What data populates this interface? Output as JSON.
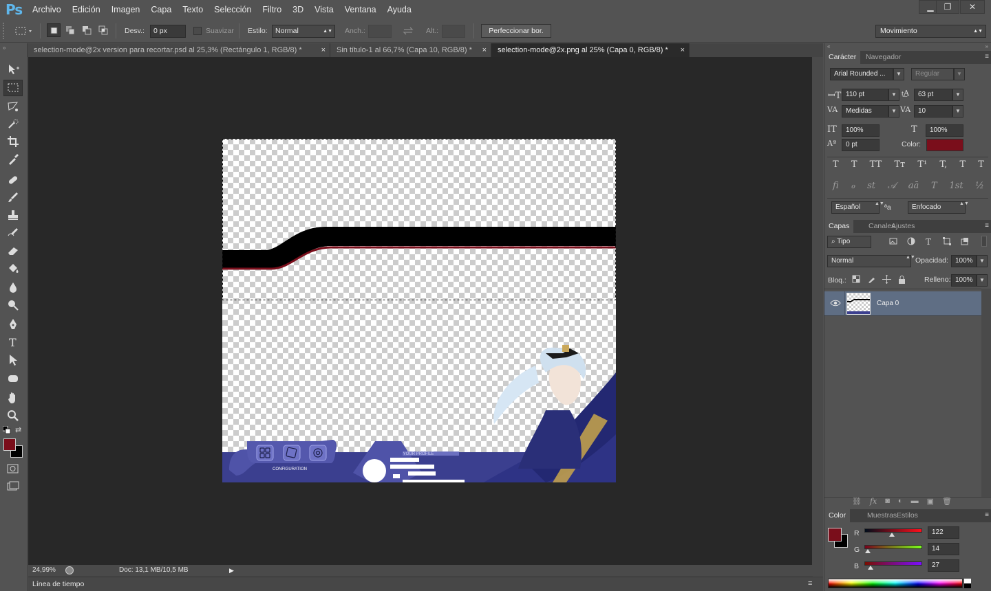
{
  "app": {
    "logo": "Ps",
    "accent": "#5fb7ec"
  },
  "menu": [
    "Archivo",
    "Edición",
    "Imagen",
    "Capa",
    "Texto",
    "Selección",
    "Filtro",
    "3D",
    "Vista",
    "Ventana",
    "Ayuda"
  ],
  "window_controls": {
    "minimize": "▁",
    "restore": "❐",
    "close": "✕"
  },
  "options": {
    "desv_label": "Desv.:",
    "desv_value": "0 px",
    "suavizar_label": "Suavizar",
    "estilo_label": "Estilo:",
    "estilo_value": "Normal",
    "anch_label": "Anch.:",
    "alt_label": "Alt.:",
    "refine_button": "Perfeccionar bor.",
    "workspace": "Movimiento"
  },
  "doc_tabs": [
    {
      "label": "selection-mode@2x version para recortar.psd al 25,3% (Rectángulo 1, RGB/8) *",
      "active": false
    },
    {
      "label": "Sin título-1 al 66,7% (Capa 10, RGB/8) *",
      "active": false
    },
    {
      "label": "selection-mode@2x.png al 25% (Capa 0, RGB/8) *",
      "active": true
    }
  ],
  "tools": [
    "move-tool",
    "marquee-tool",
    "lasso-tool",
    "quick-select-tool",
    "crop-tool",
    "eyedropper-tool",
    "healing-tool",
    "brush-tool",
    "stamp-tool",
    "history-brush-tool",
    "eraser-tool",
    "paint-bucket-tool",
    "blur-tool",
    "dodge-tool",
    "pen-tool",
    "type-tool",
    "path-select-tool",
    "shape-tool",
    "hand-tool",
    "zoom-tool"
  ],
  "colors": {
    "foreground": "#7a0e1b",
    "background": "#000000"
  },
  "status": {
    "zoom": "24,99%",
    "doc": "Doc: 13,1 MB/10,5 MB"
  },
  "timeline_label": "Línea de tiempo",
  "character_panel": {
    "tabs": [
      "Carácter",
      "Navegador"
    ],
    "font_family": "Arial Rounded ...",
    "font_style": "Regular",
    "size": "110 pt",
    "leading": "63 pt",
    "kerning": "Medidas",
    "tracking": "10",
    "vscale": "100%",
    "hscale": "100%",
    "baseline": "0 pt",
    "color_label": "Color:",
    "text_color": "#7a0e1b",
    "language": "Español",
    "aa_icon": "ªa",
    "antialias": "Enfocado",
    "style_glyphs": [
      "T",
      "T",
      "TT",
      "Tт",
      "T¹",
      "T,",
      "T",
      "T"
    ],
    "ot_glyphs": [
      "fi",
      "ℴ",
      "st",
      "𝒜",
      "aā",
      "T",
      "1st",
      "½"
    ]
  },
  "layers_panel": {
    "tabs": [
      "Capas",
      "Canales",
      "Ajustes"
    ],
    "filter": "Tipo",
    "blend": "Normal",
    "opacity_label": "Opacidad:",
    "opacity": "100%",
    "lock_label": "Bloq.:",
    "fill_label": "Relleno:",
    "fill": "100%",
    "layers": [
      {
        "name": "Capa 0",
        "visible": true,
        "selected": true
      }
    ]
  },
  "color_panel": {
    "tabs": [
      "Color",
      "Muestras",
      "Estilos"
    ],
    "channels": [
      {
        "label": "R",
        "value": "122",
        "fraction": 0.478
      },
      {
        "label": "G",
        "value": "14",
        "fraction": 0.055
      },
      {
        "label": "B",
        "value": "27",
        "fraction": 0.106
      }
    ]
  },
  "document": {
    "bottom_labels": {
      "config": "CONFIGURATION",
      "profile": "YOUR PROFILE"
    },
    "brand_dark": "#000000",
    "brand_red": "#7a0e1b",
    "brand_navy": "#3b3f8f"
  }
}
